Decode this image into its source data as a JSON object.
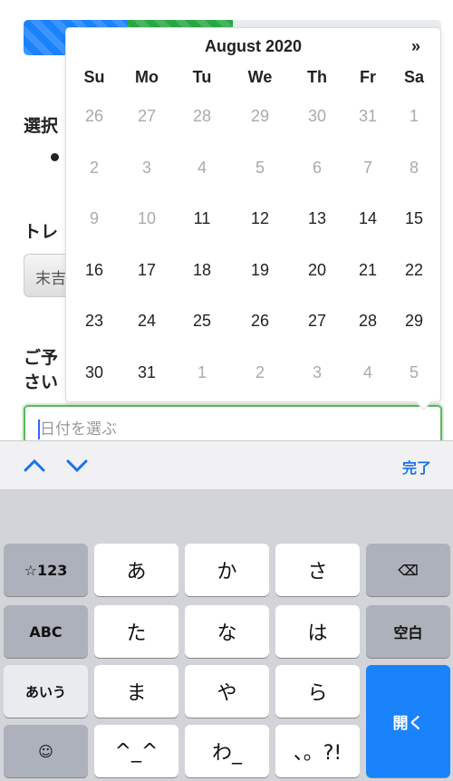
{
  "progress": {
    "segments": [
      {
        "color": "#1a82fb",
        "percent": 25
      },
      {
        "color": "#28a745",
        "percent": 25
      }
    ]
  },
  "form": {
    "label1": "選択",
    "label2": "トレ",
    "select_value": "末吉",
    "label3a": "ご予",
    "label3b": "さい",
    "date_placeholder": "日付を選ぶ"
  },
  "calendar": {
    "title": "August 2020",
    "next": "»",
    "weekdays": [
      "Su",
      "Mo",
      "Tu",
      "We",
      "Th",
      "Fr",
      "Sa"
    ],
    "weeks": [
      [
        "26",
        "27",
        "28",
        "29",
        "30",
        "31",
        "1"
      ],
      [
        "2",
        "3",
        "4",
        "5",
        "6",
        "7",
        "8"
      ],
      [
        "9",
        "10",
        "11",
        "12",
        "13",
        "14",
        "15"
      ],
      [
        "16",
        "17",
        "18",
        "19",
        "20",
        "21",
        "22"
      ],
      [
        "23",
        "24",
        "25",
        "26",
        "27",
        "28",
        "29"
      ],
      [
        "30",
        "31",
        "1",
        "2",
        "3",
        "4",
        "5"
      ]
    ],
    "disabled": [
      [
        1,
        1,
        1,
        1,
        1,
        1,
        1
      ],
      [
        1,
        1,
        1,
        1,
        1,
        1,
        1
      ],
      [
        1,
        1,
        0,
        0,
        0,
        0,
        0
      ],
      [
        0,
        0,
        0,
        0,
        0,
        0,
        0
      ],
      [
        0,
        0,
        0,
        0,
        0,
        0,
        0
      ],
      [
        0,
        0,
        1,
        1,
        1,
        1,
        1
      ]
    ]
  },
  "toolbar": {
    "done": "完了",
    "accent": "#1a73e8"
  },
  "keyboard": {
    "keys": [
      "☆123",
      "あ",
      "か",
      "さ",
      "⌫",
      "ABC",
      "た",
      "な",
      "は",
      "空白",
      "あいう",
      "ま",
      "や",
      "ら",
      "開く",
      "☺",
      "^_^",
      "わ_",
      "、。?!"
    ]
  }
}
